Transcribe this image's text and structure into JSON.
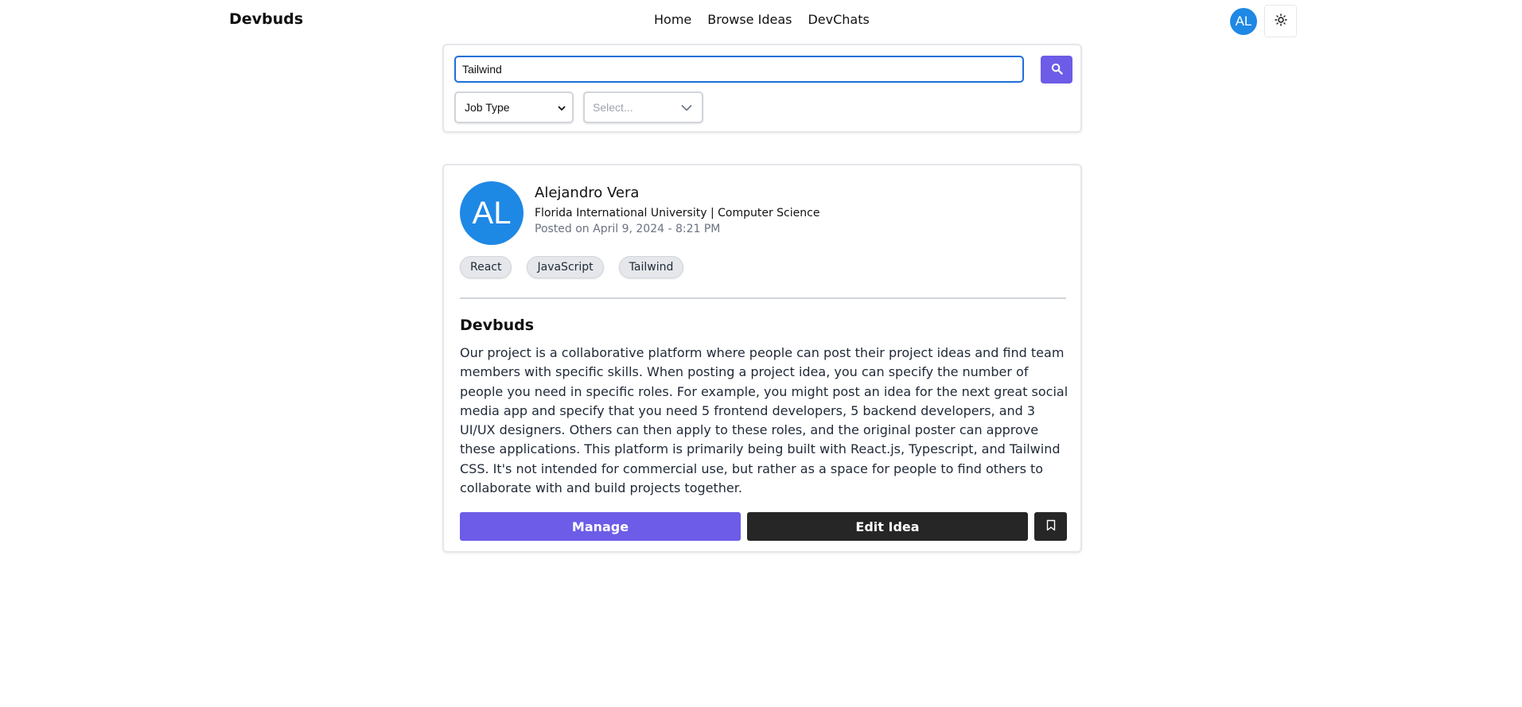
{
  "header": {
    "brand": "Devbuds",
    "nav": [
      "Home",
      "Browse Ideas",
      "DevChats"
    ],
    "user_initials": "AL"
  },
  "filters": {
    "search_value": "Tailwind",
    "job_type_label": "Job Type",
    "skills_placeholder": "Select..."
  },
  "post": {
    "author_initials": "AL",
    "author_name": "Alejandro Vera",
    "author_school": "Florida International University | Computer Science",
    "posted": "Posted on April 9, 2024 - 8:21 PM",
    "tags": [
      "React",
      "JavaScript",
      "Tailwind"
    ],
    "title": "Devbuds",
    "description": "Our project is a collaborative platform where people can post their project ideas and find team members with specific skills. When posting a project idea, you can specify the number of people you need in specific roles. For example, you might post an idea for the next great social media app and specify that you need 5 frontend developers, 5 backend developers, and 3 UI/UX designers. Others can then apply to these roles, and the original poster can approve these applications. This platform is primarily being built with React.js, Typescript, and Tailwind CSS. It's not intended for commercial use, but rather as a space for people to find others to collaborate with and build projects together.",
    "manage_label": "Manage",
    "edit_label": "Edit Idea"
  },
  "colors": {
    "accent": "#6c5ce7",
    "avatar": "#1e88e5",
    "dark_button": "#262626"
  },
  "icons": [
    "search-icon",
    "sun-icon",
    "chevron-down-icon",
    "bookmark-icon"
  ]
}
